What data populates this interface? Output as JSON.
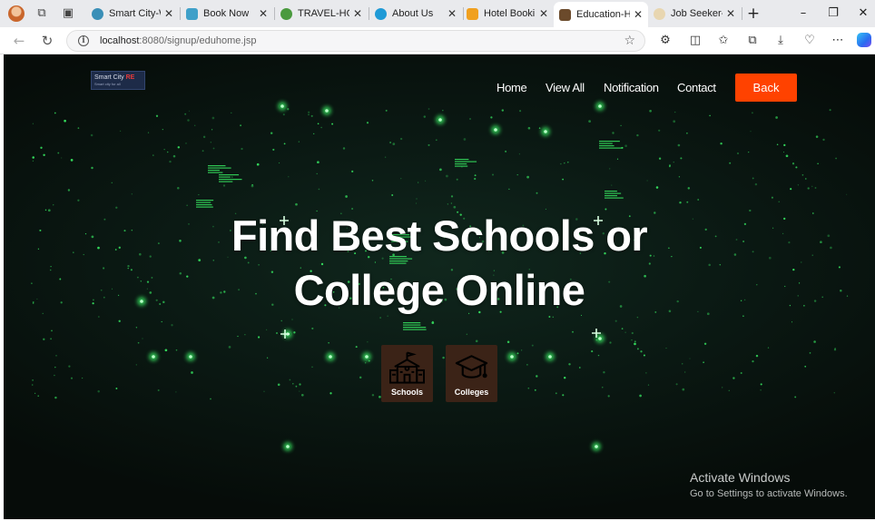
{
  "browser": {
    "tabs": [
      {
        "title": "Smart City-Welc",
        "favicon": "globe-teal-icon",
        "active": false
      },
      {
        "title": "Book Now",
        "favicon": "plane-icon",
        "active": false
      },
      {
        "title": "TRAVEL-HOME",
        "favicon": "globe-icon",
        "active": false
      },
      {
        "title": "About Us",
        "favicon": "info-circle-icon",
        "active": false
      },
      {
        "title": "Hotel Booking",
        "favicon": "hotel-icon",
        "active": false
      },
      {
        "title": "Education-Hom",
        "favicon": "book-icon",
        "active": true
      },
      {
        "title": "Job Seeker-Hon",
        "favicon": "tag-icon",
        "active": false
      }
    ],
    "address": {
      "host": "localhost",
      "path": ":8080/signup/eduhome.jsp"
    }
  },
  "site": {
    "logo": {
      "line1": "Smart City",
      "mark": "RE",
      "tagline": "Smart city for all"
    },
    "nav": [
      "Home",
      "View All",
      "Notification",
      "Contact"
    ],
    "back_label": "Back",
    "hero_line1": "Find Best Schools or",
    "hero_line2": "College Online",
    "categories": [
      {
        "label": "Schools",
        "icon": "school-building-icon"
      },
      {
        "label": "Colleges",
        "icon": "graduation-cap-icon"
      }
    ]
  },
  "os_watermark": {
    "title": "Activate Windows",
    "subtitle": "Go to Settings to activate Windows."
  },
  "colors": {
    "accent": "#ff4200",
    "category_bg": "#3b2317",
    "background": "#0b1a14",
    "particles": "#3cff6a"
  }
}
